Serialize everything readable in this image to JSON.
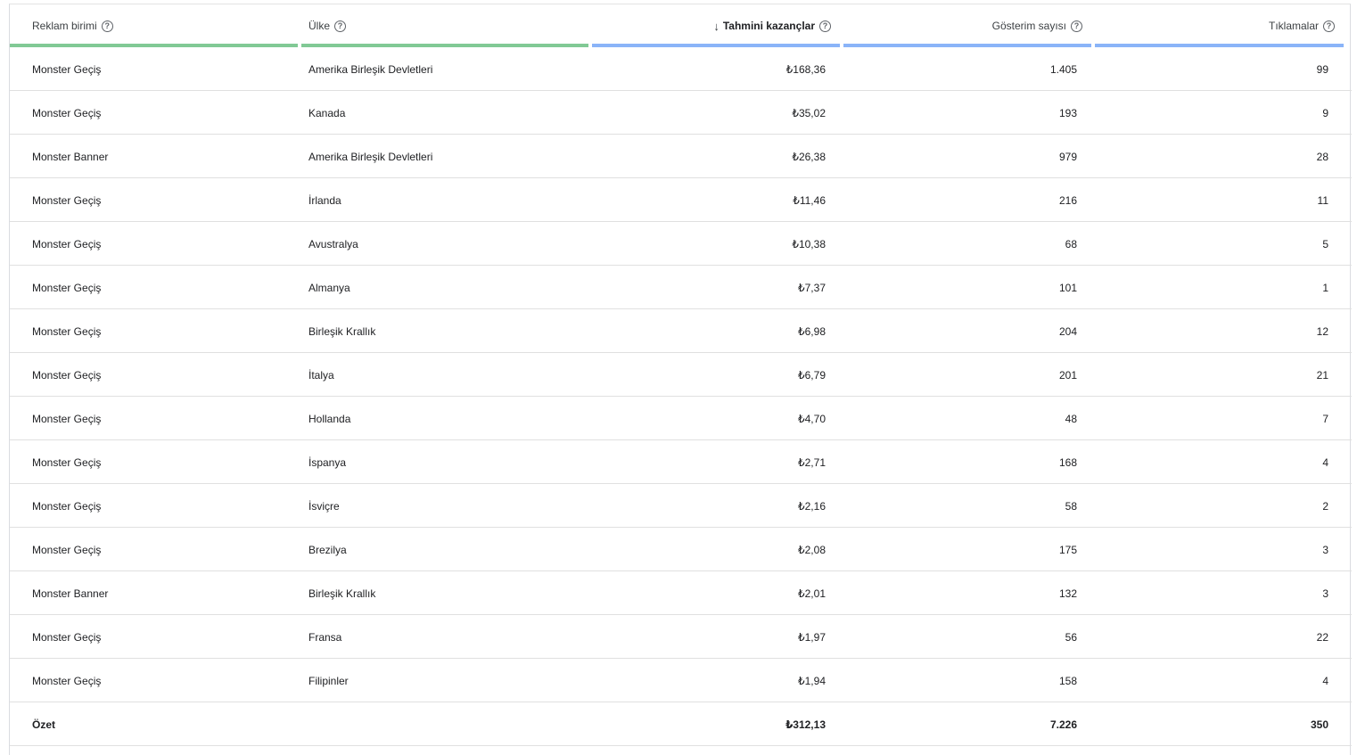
{
  "columns": [
    {
      "label": "Reklam birimi",
      "align": "left",
      "bar_color": "#81c995",
      "sorted": false
    },
    {
      "label": "Ülke",
      "align": "left",
      "bar_color": "#81c995",
      "sorted": false
    },
    {
      "label": "Tahmini kazançlar",
      "align": "right",
      "bar_color": "#8ab4f8",
      "sorted": true,
      "sort_icon": "arrow-down-icon"
    },
    {
      "label": "Gösterim sayısı",
      "align": "right",
      "bar_color": "#8ab4f8",
      "sorted": false
    },
    {
      "label": "Tıklamalar",
      "align": "right",
      "bar_color": "#8ab4f8",
      "sorted": false
    }
  ],
  "help_icon_glyph": "?",
  "sort_arrow_glyph": "↓",
  "rows": [
    [
      "Monster Geçiş",
      "Amerika Birleşik Devletleri",
      "₺168,36",
      "1.405",
      "99"
    ],
    [
      "Monster Geçiş",
      "Kanada",
      "₺35,02",
      "193",
      "9"
    ],
    [
      "Monster Banner",
      "Amerika Birleşik Devletleri",
      "₺26,38",
      "979",
      "28"
    ],
    [
      "Monster Geçiş",
      "İrlanda",
      "₺11,46",
      "216",
      "11"
    ],
    [
      "Monster Geçiş",
      "Avustralya",
      "₺10,38",
      "68",
      "5"
    ],
    [
      "Monster Geçiş",
      "Almanya",
      "₺7,37",
      "101",
      "1"
    ],
    [
      "Monster Geçiş",
      "Birleşik Krallık",
      "₺6,98",
      "204",
      "12"
    ],
    [
      "Monster Geçiş",
      "İtalya",
      "₺6,79",
      "201",
      "21"
    ],
    [
      "Monster Geçiş",
      "Hollanda",
      "₺4,70",
      "48",
      "7"
    ],
    [
      "Monster Geçiş",
      "İspanya",
      "₺2,71",
      "168",
      "4"
    ],
    [
      "Monster Geçiş",
      "İsviçre",
      "₺2,16",
      "58",
      "2"
    ],
    [
      "Monster Geçiş",
      "Brezilya",
      "₺2,08",
      "175",
      "3"
    ],
    [
      "Monster Banner",
      "Birleşik Krallık",
      "₺2,01",
      "132",
      "3"
    ],
    [
      "Monster Geçiş",
      "Fransa",
      "₺1,97",
      "56",
      "22"
    ],
    [
      "Monster Geçiş",
      "Filipinler",
      "₺1,94",
      "158",
      "4"
    ]
  ],
  "summary": [
    "Özet",
    "",
    "₺312,13",
    "7.226",
    "350"
  ]
}
